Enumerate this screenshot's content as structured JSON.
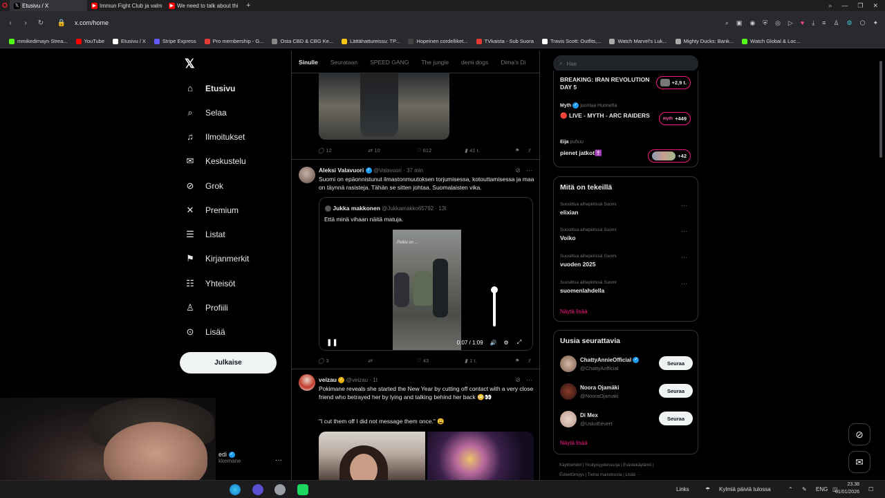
{
  "browser": {
    "tabs": [
      {
        "title": "Etusivu / X",
        "icon": "x-icon"
      },
      {
        "title": "Immun Fight Club ja valm",
        "icon": "youtube-icon"
      },
      {
        "title": "We need to talk about thi",
        "icon": "youtube-icon"
      }
    ],
    "url": "x.com/home",
    "bookmarks": [
      {
        "label": "mmikedimayn Strea...",
        "color": "#53fc18"
      },
      {
        "label": "YouTube",
        "color": "#ff0000"
      },
      {
        "label": "Etusivu / X",
        "color": "#ffffff"
      },
      {
        "label": "Stripe Express",
        "color": "#635bff"
      },
      {
        "label": "Pro membership - G...",
        "color": "#e53935"
      },
      {
        "label": "Osta CBD & CBG Ke...",
        "color": "#888888"
      },
      {
        "label": "Lättähattureissu: TP...",
        "color": "#f5c518"
      },
      {
        "label": "Hopeinen cordelliket...",
        "color": "#444444"
      },
      {
        "label": "TVkaista - Sub Suora",
        "color": "#e53935"
      },
      {
        "label": "Travis Scott: Outfits,...",
        "color": "#ffffff"
      },
      {
        "label": "Watch Marvel's Luk...",
        "color": "#aaaaaa"
      },
      {
        "label": "Mighty Ducks: Bank...",
        "color": "#aaaaaa"
      },
      {
        "label": "Watch Global & Loc...",
        "color": "#53fc18"
      }
    ]
  },
  "nav": {
    "items": [
      {
        "label": "Etusivu",
        "icon": "home-icon",
        "glyph": "⌂"
      },
      {
        "label": "Selaa",
        "icon": "search-icon",
        "glyph": "⌕"
      },
      {
        "label": "Ilmoitukset",
        "icon": "bell-icon",
        "glyph": "♫"
      },
      {
        "label": "Keskustelu",
        "icon": "mail-icon",
        "glyph": "✉"
      },
      {
        "label": "Grok",
        "icon": "grok-icon",
        "glyph": "⊘"
      },
      {
        "label": "Premium",
        "icon": "x-premium-icon",
        "glyph": "✕"
      },
      {
        "label": "Listat",
        "icon": "list-icon",
        "glyph": "☰"
      },
      {
        "label": "Kirjanmerkit",
        "icon": "bookmark-icon",
        "glyph": "⚑"
      },
      {
        "label": "Yhteisöt",
        "icon": "communities-icon",
        "glyph": "☷"
      },
      {
        "label": "Profiili",
        "icon": "profile-icon",
        "glyph": "♙"
      },
      {
        "label": "Lisää",
        "icon": "more-icon",
        "glyph": "⊙"
      }
    ],
    "post_button": "Julkaise",
    "account_name": "edi",
    "account_handle": "kkemane"
  },
  "feed": {
    "tabs": [
      "Sinulle",
      "Seurataan",
      "SPEED GANG",
      "The jungle",
      "demi dogs",
      "Dima's Di"
    ],
    "prev_actions": {
      "replies": "12",
      "reposts": "10",
      "likes": "612",
      "views": "41 t."
    },
    "tweet1": {
      "name": "Aleksi Valavuori",
      "handle": "@Valavuori",
      "time": "· 37 min",
      "text": "Suomi on epäonnistunut ilmastonmuutoksen torjumisessa, kotouttamisessa ja maa on täynnä rasisteja. Tähän se sitten johtaa. Suomalaisten vika.",
      "quote": {
        "name": "Jukka makkonen",
        "handle": "@Jukkamakko65792",
        "time": "· 13t",
        "text": "Että minä vihaan näitä matuja.",
        "video_time": "0:07 / 1:09"
      },
      "actions": {
        "replies": "3",
        "reposts": "",
        "likes": "43",
        "views": "1 t."
      }
    },
    "tweet2": {
      "name": "veizau",
      "handle": "@veizau",
      "time": "· 1t",
      "text1": "Pokimane reveals she started the New Year by cutting off contact with a very close friend who betrayed her by lying and talking behind her back 😳👀",
      "text2": "\"I cut them off I did not message them once.\" 😩"
    }
  },
  "right": {
    "search_placeholder": "Hae",
    "live": [
      {
        "meta": "",
        "title": "BREAKING: IRAN REVOLUTION DAY 5",
        "count": "+2,9 t."
      },
      {
        "meta_name": "Myth",
        "meta": "juontaa Huonetta",
        "title": "🔴 LIVE - MYTH - ARC RAIDERS",
        "count": "+449"
      },
      {
        "meta_name": "Eija",
        "meta": "puhuu",
        "title": "pienet jatkot✝️",
        "count": "+42"
      }
    ],
    "trends_title": "Mitä on tekeillä",
    "trends": [
      {
        "context": "Suosittua aihepiirissä Suomi",
        "name": "elixian"
      },
      {
        "context": "Suosittua aihepiirissä Suomi",
        "name": "Voiko"
      },
      {
        "context": "Suosittua aihepiirissä Suomi",
        "name": "vuoden 2025"
      },
      {
        "context": "Suosittua aihepiirissä Suomi",
        "name": "suomenlahdella"
      }
    ],
    "show_more": "Näytä lisää",
    "who_title": "Uusia seurattavia",
    "who": [
      {
        "name": "ChattyAnnieOfficial",
        "handle": "@ChattyAofficial",
        "button": "Seuraa"
      },
      {
        "name": "Noora Ojamäki",
        "handle": "@NooraOjamaki",
        "button": "Seuraa"
      },
      {
        "name": "Di Mex",
        "handle": "@UskoEevert",
        "button": "Seuraa"
      }
    ],
    "footer1": "Käyttöehdot | Yksityisyydensuoja | Evästekäytäntö |",
    "footer2": "Esteettömyys | Tietoa mainoksista | Lisää ···"
  },
  "taskbar": {
    "links": "Links",
    "weather": "Kylmiä päiviä tulossa",
    "lang": "ENG",
    "time": "23.38",
    "date": "01/01/2026"
  }
}
